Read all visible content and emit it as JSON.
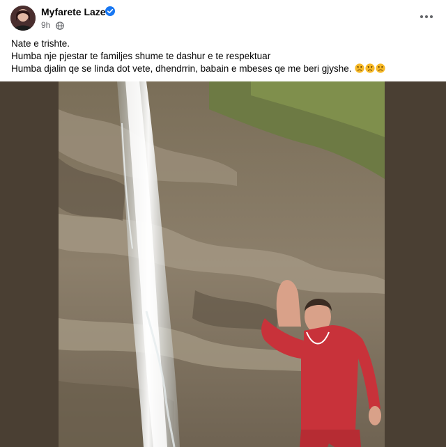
{
  "post": {
    "author": "Myfarete Laze",
    "time": "9h",
    "more_label": "•••",
    "caption_line1": "Nate e trishte.",
    "caption_line2": "Humba nje pjestar te familjes shume te dashur e te respektuar",
    "caption_line3": "Humba djalin qe se linda dot vete,  dhendrrin, babain e mbeses qe me beri gjyshe.",
    "caption_emojis": [
      "sad-face-emoji",
      "sad-face-emoji",
      "sad-face-emoji"
    ]
  },
  "colors": {
    "verified_badge": "#1877f2",
    "secondary_text": "#65676b",
    "emoji_yellow": "#f7b928",
    "photo_sidebar": "#4a3f33",
    "hoodie_red": "#c8323a"
  },
  "icons": {
    "verified": "verified-badge-icon",
    "audience": "globe-icon",
    "more": "more-options-icon"
  }
}
